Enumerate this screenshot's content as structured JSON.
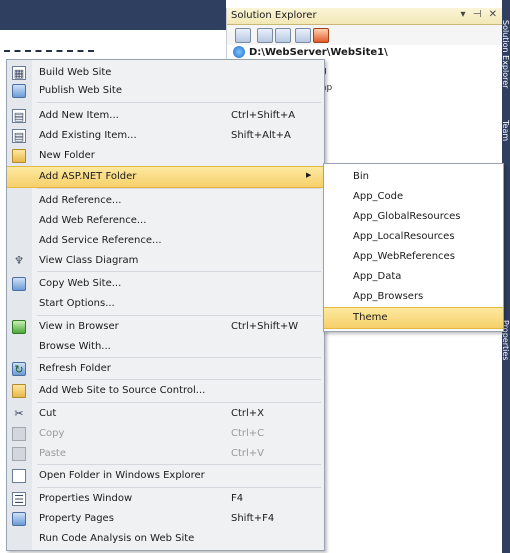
{
  "solution_explorer": {
    "title": "Solution Explorer",
    "title_buttons": "▾ ⊣ ✕",
    "root_node": "D:\\WebServer\\WebSite1\\",
    "tree_fragments": [
      "g",
      "ap"
    ]
  },
  "context_menu": {
    "items": [
      {
        "label": "Build Web Site",
        "shortcut": "",
        "icon": "build-icon"
      },
      {
        "label": "Publish Web Site",
        "shortcut": "",
        "icon": "publish-icon"
      },
      {
        "label": "Add New Item...",
        "shortcut": "Ctrl+Shift+A",
        "icon": "new-item-icon"
      },
      {
        "label": "Add Existing Item...",
        "shortcut": "Shift+Alt+A",
        "icon": "existing-item-icon"
      },
      {
        "label": "New Folder",
        "shortcut": "",
        "icon": "folder-icon"
      },
      {
        "label": "Add ASP.NET Folder",
        "shortcut": "",
        "icon": "",
        "submenu_arrow": "▶"
      },
      {
        "label": "Add Reference...",
        "shortcut": "",
        "icon": ""
      },
      {
        "label": "Add Web Reference...",
        "shortcut": "",
        "icon": ""
      },
      {
        "label": "Add Service Reference...",
        "shortcut": "",
        "icon": ""
      },
      {
        "label": "View Class Diagram",
        "shortcut": "",
        "icon": "class-diagram-icon"
      },
      {
        "label": "Copy Web Site...",
        "shortcut": "",
        "icon": "copy-site-icon"
      },
      {
        "label": "Start Options...",
        "shortcut": "",
        "icon": ""
      },
      {
        "label": "View in Browser",
        "shortcut": "Ctrl+Shift+W",
        "icon": "browser-icon"
      },
      {
        "label": "Browse With...",
        "shortcut": "",
        "icon": ""
      },
      {
        "label": "Refresh Folder",
        "shortcut": "",
        "icon": "refresh-icon"
      },
      {
        "label": "Add Web Site to Source Control...",
        "shortcut": "",
        "icon": "source-control-icon"
      },
      {
        "label": "Cut",
        "shortcut": "Ctrl+X",
        "icon": "cut-icon"
      },
      {
        "label": "Copy",
        "shortcut": "Ctrl+C",
        "icon": "copy-icon"
      },
      {
        "label": "Paste",
        "shortcut": "Ctrl+V",
        "icon": "paste-icon"
      },
      {
        "label": "Open Folder in Windows Explorer",
        "shortcut": "",
        "icon": "open-folder-icon"
      },
      {
        "label": "Properties Window",
        "shortcut": "F4",
        "icon": "properties-icon"
      },
      {
        "label": "Property Pages",
        "shortcut": "Shift+F4",
        "icon": "property-pages-icon"
      },
      {
        "label": "Run Code Analysis on Web Site",
        "shortcut": "",
        "icon": ""
      }
    ]
  },
  "aspnet_submenu": {
    "items": [
      "Bin",
      "App_Code",
      "App_GlobalResources",
      "App_LocalResources",
      "App_WebReferences",
      "App_Data",
      "App_Browsers",
      "Theme"
    ],
    "highlighted": "Theme"
  },
  "side_tabs": [
    "Solution Explorer",
    "Team",
    "Properties"
  ]
}
